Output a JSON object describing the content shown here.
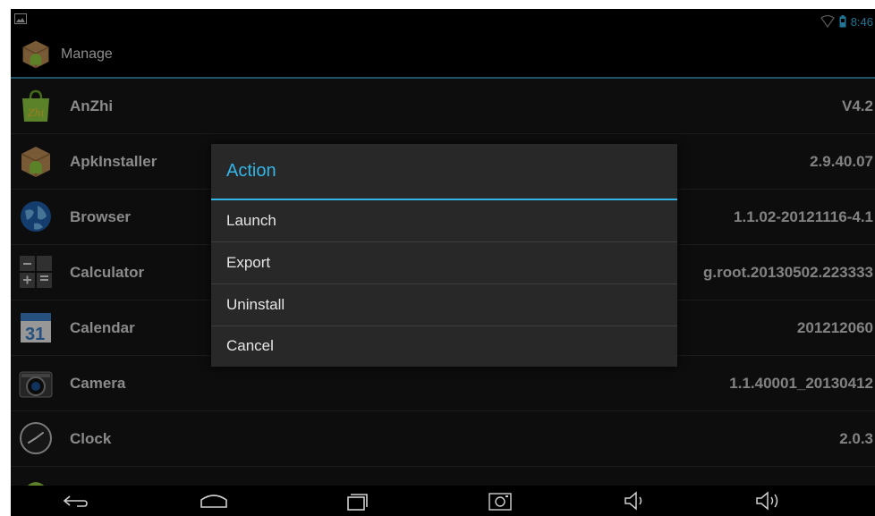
{
  "status_bar": {
    "time": "8:46",
    "icons": [
      "gallery-notification-icon",
      "wifi-icon",
      "battery-icon"
    ]
  },
  "action_bar": {
    "title": "Manage",
    "icon": "apk-installer-icon"
  },
  "apps": [
    {
      "name": "AnZhi",
      "version": "V4.2",
      "icon": "anzhi-bag-icon"
    },
    {
      "name": "ApkInstaller",
      "version": "2.9.40.07",
      "icon": "apk-installer-icon"
    },
    {
      "name": "Browser",
      "version": "1.1.02-20121116-4.1",
      "icon": "globe-icon"
    },
    {
      "name": "Calculator",
      "version": "g.root.20130502.223333",
      "icon": "calculator-icon"
    },
    {
      "name": "Calendar",
      "version": "201212060",
      "icon": "calendar-icon"
    },
    {
      "name": "Camera",
      "version": "1.1.40001_20130412",
      "icon": "camera-icon"
    },
    {
      "name": "Clock",
      "version": "2.0.3",
      "icon": "clock-icon"
    }
  ],
  "dialog": {
    "title": "Action",
    "items": [
      "Launch",
      "Export",
      "Uninstall",
      "Cancel"
    ]
  },
  "nav_bar": {
    "buttons": [
      "back-icon",
      "home-icon",
      "recents-icon",
      "screenshot-icon",
      "volume-down-icon",
      "volume-up-icon"
    ]
  },
  "colors": {
    "accent": "#33b5e5",
    "background": "#000000",
    "list_background": "#151515",
    "dialog_background": "#282828"
  }
}
